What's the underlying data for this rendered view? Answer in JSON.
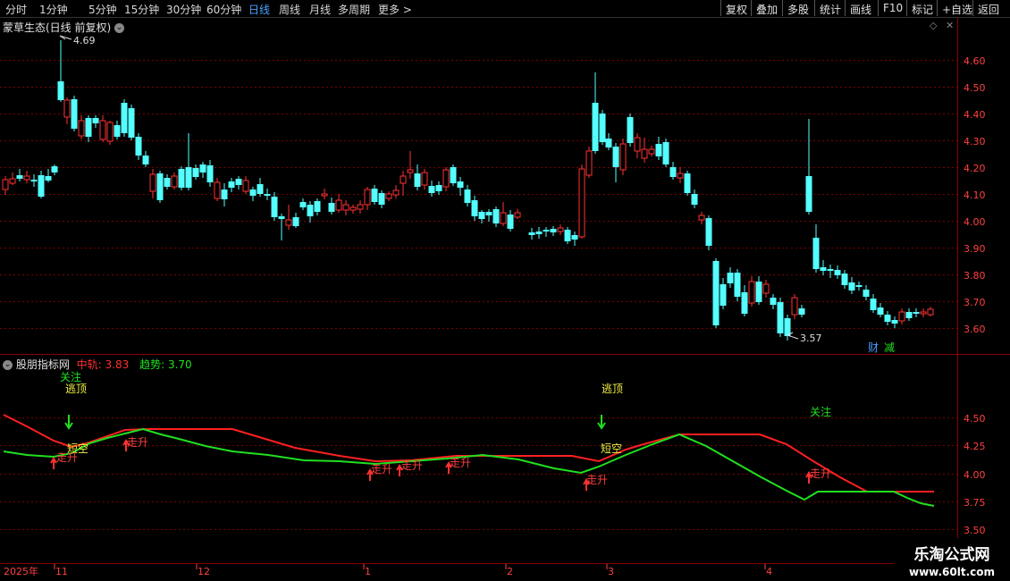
{
  "toolbar": {
    "timeframes": [
      "分时",
      "1分钟",
      "5分钟",
      "15分钟",
      "30分钟",
      "60分钟",
      "日线",
      "周线",
      "月线",
      "多周期",
      "更多 >"
    ],
    "active": "日线",
    "right_buttons": [
      "复权",
      "叠加",
      "多股",
      "统计",
      "画线",
      "F10",
      "标记",
      "+自选",
      "返回"
    ]
  },
  "main_panel": {
    "title": "蒙草生态(日线 前复权)",
    "high_label": "4.69",
    "low_label": "3.57",
    "y_ticks": [
      "4.60",
      "4.50",
      "4.40",
      "4.30",
      "4.20",
      "4.10",
      "4.00",
      "3.90",
      "3.80",
      "3.70",
      "3.60"
    ],
    "badges": [
      "财",
      "减"
    ]
  },
  "indicator_panel": {
    "title": "股朋指标网",
    "mid_label": "中轨:",
    "mid_value": "3.83",
    "trend_label": "趋势:",
    "trend_value": "3.70",
    "y_ticks": [
      "4.50",
      "4.25",
      "4.00",
      "3.75",
      "3.50"
    ],
    "signals": {
      "watch": "关注",
      "escape": "逃顶",
      "short": "短空",
      "up": "走升"
    }
  },
  "date_axis": [
    "2025年",
    "11",
    "12",
    "1",
    "2",
    "3",
    "4"
  ],
  "watermark": {
    "title": "乐淘公式网",
    "url": "www.60lt.com"
  },
  "colors": {
    "up": "#ff3232",
    "down": "#54ffff",
    "mid": "#ff2020",
    "trend": "#20e020",
    "grid": "#7a0000",
    "label_red": "#ff4040"
  }
}
